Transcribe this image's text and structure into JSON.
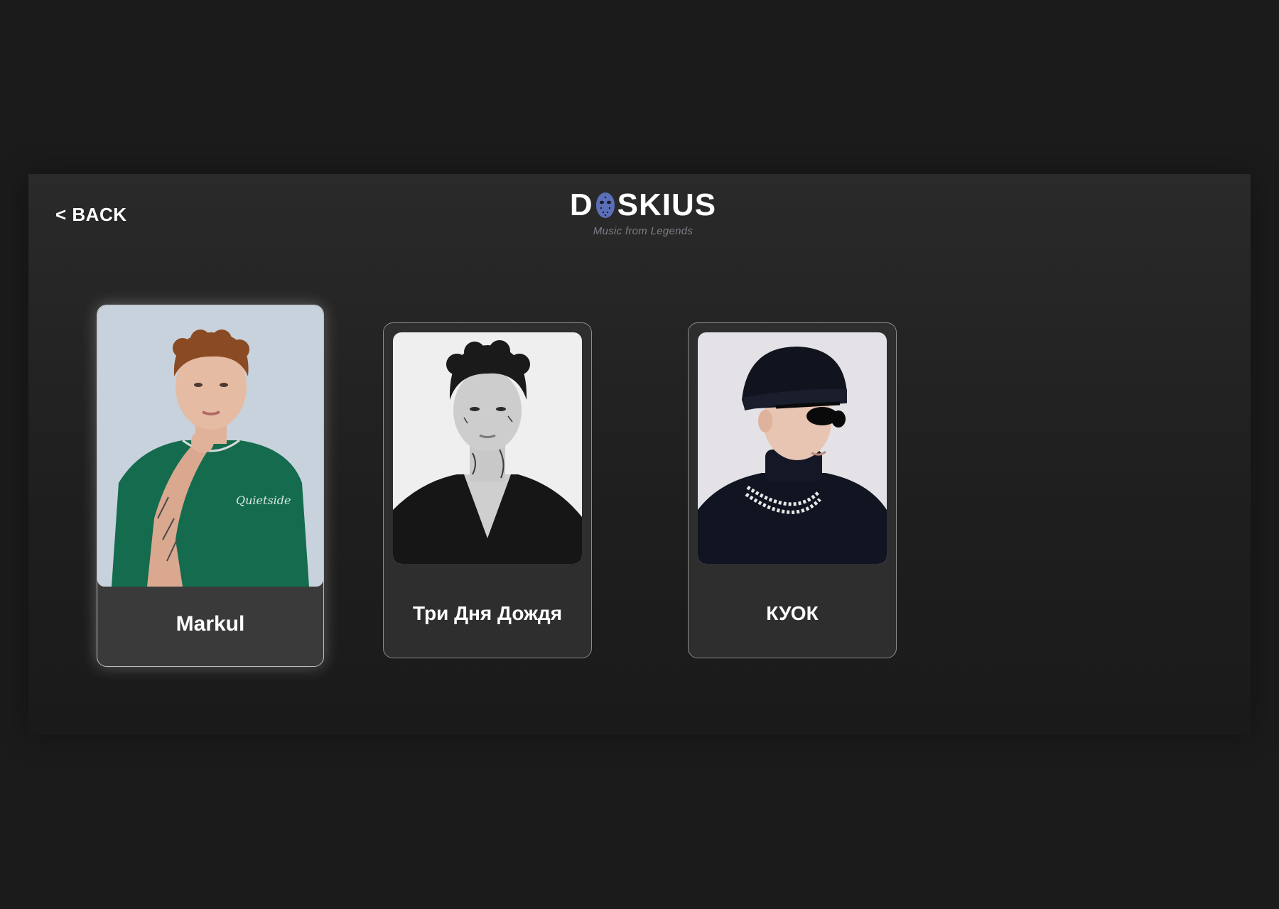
{
  "nav": {
    "back_label": "< BACK"
  },
  "brand": {
    "logo_left": "D",
    "logo_right": "SKIUS",
    "tagline": "Music from Legends",
    "mask_icon": "hockey-mask-icon"
  },
  "artists": [
    {
      "name": "Markul",
      "selected": true,
      "photo_icon": "artist-portrait"
    },
    {
      "name": "Три Дня Дождя",
      "selected": false,
      "photo_icon": "artist-portrait"
    },
    {
      "name": "КУОК",
      "selected": false,
      "photo_icon": "artist-portrait"
    }
  ],
  "colors": {
    "page_bg": "#1b1b1b",
    "card_border": "#8a8a8a",
    "mask_blue": "#5b6fb8",
    "markul_shirt": "#146b4e",
    "photo_bg_1": "#c8d2dc",
    "photo_bg_2": "#efefef",
    "photo_bg_3": "#e4e2e6"
  }
}
